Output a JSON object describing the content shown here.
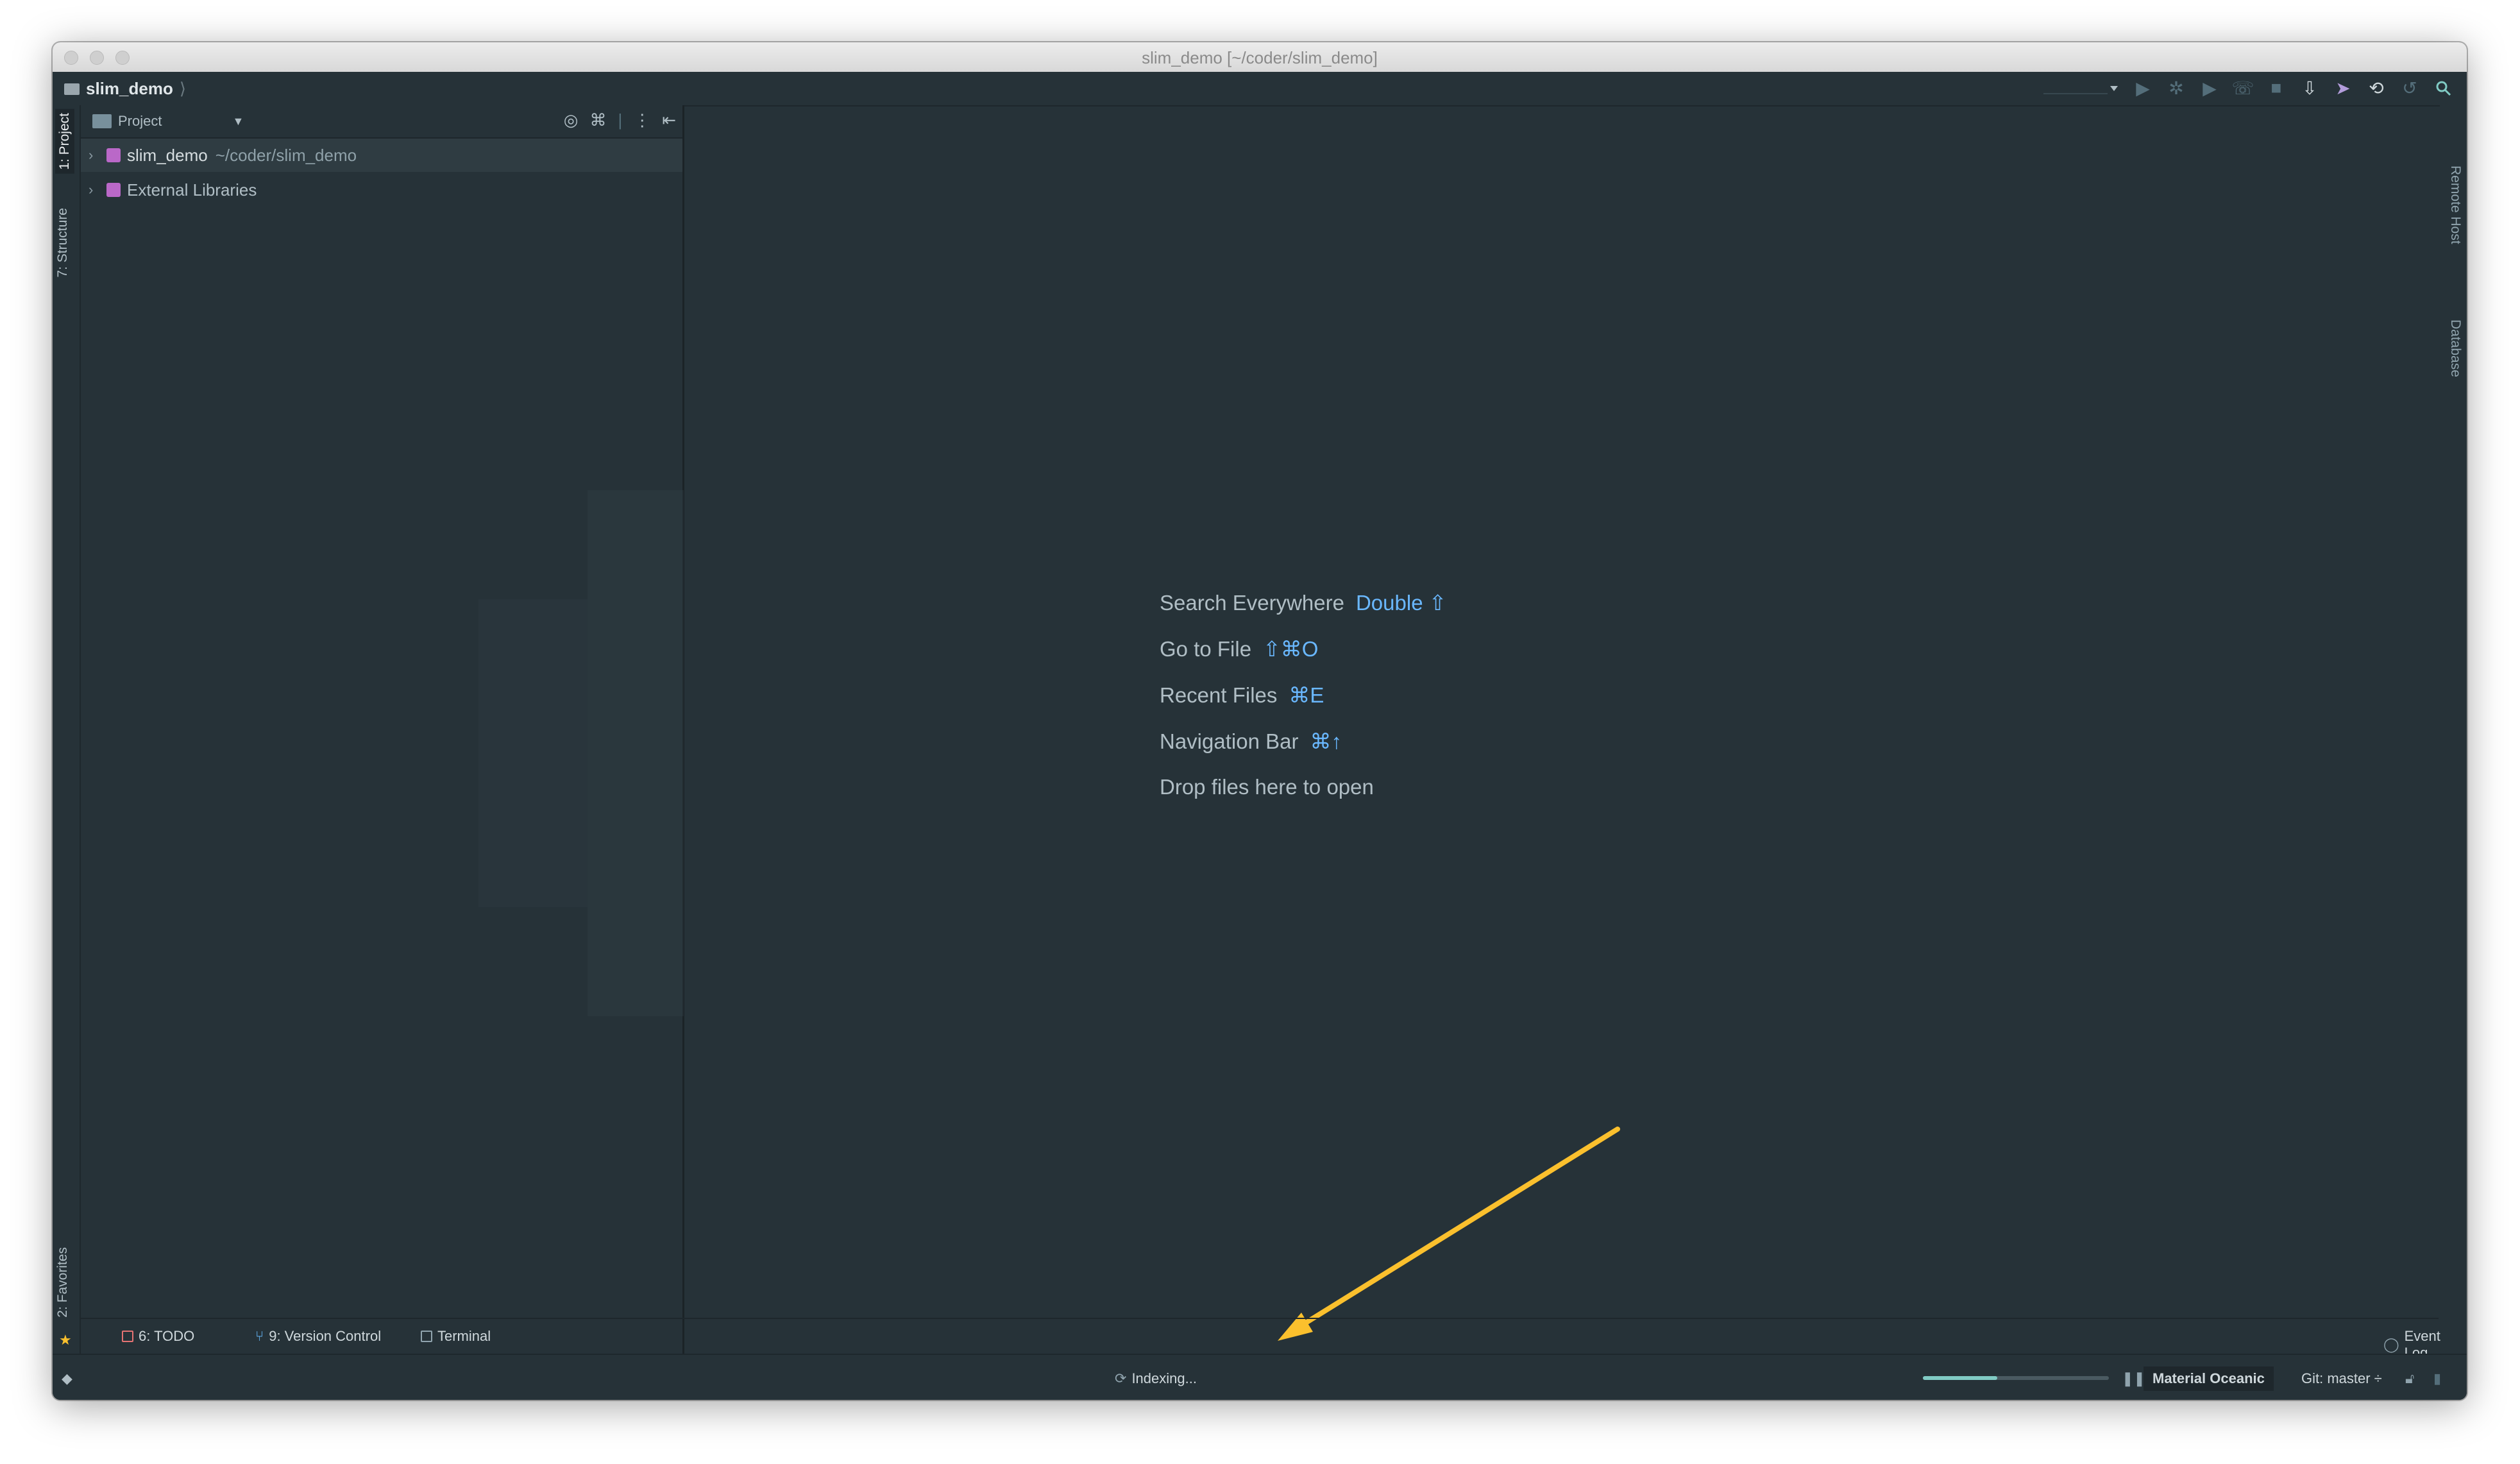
{
  "window": {
    "title": "slim_demo [~/coder/slim_demo]"
  },
  "navbar": {
    "crumb": "slim_demo",
    "crumb_sep": "⟩"
  },
  "left_tabs": {
    "project": "1: Project",
    "structure": "7: Structure",
    "favorites": "2: Favorites"
  },
  "right_tabs": {
    "remote_host": "Remote Host",
    "database": "Database"
  },
  "project_panel": {
    "title": "Project",
    "tree": [
      {
        "label": "slim_demo",
        "path": "~/coder/slim_demo"
      },
      {
        "label": "External Libraries"
      }
    ]
  },
  "editor_hints": [
    {
      "label": "Search Everywhere",
      "key": "Double ⇧"
    },
    {
      "label": "Go to File",
      "key": "⇧⌘O"
    },
    {
      "label": "Recent Files",
      "key": "⌘E"
    },
    {
      "label": "Navigation Bar",
      "key": "⌘↑"
    },
    {
      "label": "Drop files here to open"
    }
  ],
  "bottom_tools": {
    "todo": "6: TODO",
    "vcs": "9: Version Control",
    "terminal": "Terminal",
    "event_log": "Event Log"
  },
  "status": {
    "indexing": "Indexing...",
    "progress": 0.4,
    "theme": "Material Oceanic",
    "git": "Git: master ÷"
  },
  "colors": {
    "background": "#263238",
    "accent": "#80cbc4",
    "link": "#6ab8ff",
    "arrow": "#fbc02d"
  }
}
